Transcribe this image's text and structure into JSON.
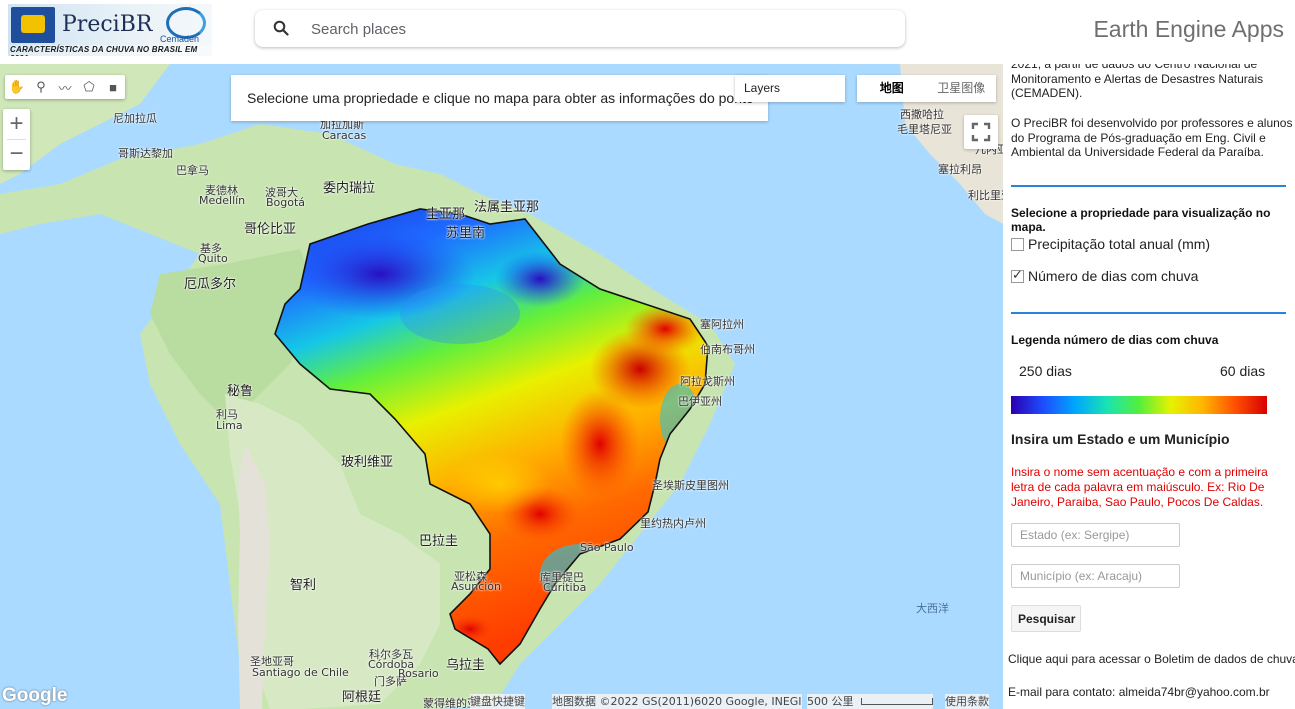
{
  "header": {
    "logo_name": "PreciBR",
    "logo_partner": "Cemaden",
    "logo_tagline": "CARACTERÍSTICAS DA CHUVA NO BRASIL EM 2021",
    "search_placeholder": "Search places",
    "app_title": "Earth Engine Apps"
  },
  "map": {
    "info_text": "Selecione uma propriedade e clique no mapa para obter as informações do ponto",
    "layers_label": "Layers",
    "map_types": [
      "地图",
      "卫星图像"
    ],
    "google_logo": "Google",
    "footer": {
      "shortcuts": "键盘快捷键",
      "attribution": "地图数据 ©2022 GS(2011)6020 Google, INEGI",
      "scale": "500 公里",
      "terms": "使用条款"
    },
    "labels": {
      "nicaragua": "尼加拉瓜",
      "costa_rica": "哥斯达黎加",
      "panama": "巴拿马",
      "caracas_zh": "加拉加斯",
      "caracas": "Caracas",
      "medellin_zh": "麦德林",
      "medellin": "Medellín",
      "bogota_zh": "波哥大",
      "bogota": "Bogotá",
      "venezuela": "委内瑞拉",
      "colombia": "哥伦比亚",
      "guyana": "圭亚那",
      "french_guiana": "法属圭亚那",
      "suriname": "苏里南",
      "quito_zh": "基多",
      "quito": "Quito",
      "ecuador": "厄瓜多尔",
      "peru": "秘鲁",
      "lima_zh": "利马",
      "lima": "Lima",
      "bolivia": "玻利维亚",
      "paraguay": "巴拉圭",
      "chile": "智利",
      "asuncion_zh": "亚松森",
      "asuncion": "Asunción",
      "santiago_zh": "圣地亚哥",
      "santiago": "Santiago de Chile",
      "cordoba_zh": "科尔多瓦",
      "cordoba": "Córdoba",
      "rosario_zh": "罗萨里奥",
      "rosario": "Rosario",
      "uruguay": "乌拉圭",
      "argentina": "阿根廷",
      "mendoza_zh": "门多萨",
      "mendoza": "Mendoza",
      "montevideo_zh": "蒙得维的亚",
      "curitiba_zh": "库里提巴",
      "curitiba": "Curitiba",
      "sao_paulo": "São Paulo",
      "atlantic": "大西洋",
      "western_sahara": "西撒哈拉",
      "mauritania": "毛里塔尼亚",
      "senegal": "塞内加尔",
      "sierra_leone": "塞拉利昂",
      "liberia": "利比里亚",
      "guinea_bissau": "几内亚比绍",
      "guinea": "几内亚",
      "ceara": "塞阿拉州",
      "rio_grande_norte": "北里奥格兰德州",
      "paraiba": "帕拉伊巴州",
      "pernambuco": "伯南布哥州",
      "alagoas": "阿拉戈斯州",
      "bahia": "巴伊亚州",
      "esp": "圣埃斯皮里图州",
      "rio": "里约热内卢州"
    }
  },
  "panel": {
    "intro_1": "2021, a partir de dados do Centro Nacional de Monitoramento e Alertas de Desastres Naturais (CEMADEN).",
    "intro_2": "O PreciBR foi desenvolvido por professores e alunos do Programa de Pós-graduação em Eng. Civil e Ambiental da Universidade Federal da Paraíba.",
    "select_heading": "Selecione a propriedade para visualização no mapa.",
    "option_1": "Precipitação total anual (mm)",
    "option_1_checked": false,
    "option_2": "Número de dias com chuva",
    "option_2_checked": true,
    "legend_title": "Legenda número de dias com chuva",
    "legend_left": "250 dias",
    "legend_right": "60 dias",
    "legend_colors": [
      "#2b00b0",
      "#1e4cff",
      "#00a6ff",
      "#19e3b2",
      "#54ef3c",
      "#e6f200",
      "#ffb400",
      "#ff5000",
      "#d80000"
    ],
    "state_heading": "Insira um Estado e um Município",
    "instruction": "Insira o nome sem acentuação e com a primeira letra de cada palavra em maiúsculo. Ex: Rio De Janeiro, Paraiba, Sao Paulo, Pocos De Caldas.",
    "state_placeholder": "Estado (ex: Sergipe)",
    "city_placeholder": "Município (ex: Aracaju)",
    "search_button": "Pesquisar",
    "bulletin_link": "Clique aqui para acessar o Boletim de dados de chuva",
    "contact": "E-mail para contato: almeida74br@yahoo.com.br"
  }
}
